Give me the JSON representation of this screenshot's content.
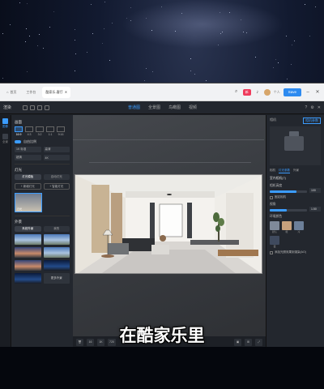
{
  "browser": {
    "tabs": [
      "首页",
      "工作台",
      "酷家乐-客厅"
    ],
    "badge": "新",
    "user": "个人",
    "save_label": "Save"
  },
  "toolbar": {
    "title": "渲染",
    "tabs": [
      "普通图",
      "全景图",
      "鸟瞰图",
      "视频"
    ],
    "active_tab": 0
  },
  "rail": {
    "items": [
      {
        "label": "图像",
        "active": true
      },
      {
        "label": "全景",
        "active": false
      }
    ]
  },
  "left_panel": {
    "size_title": "画面",
    "ratios": [
      "16:9",
      "4:3",
      "3:2",
      "1:1",
      "9:16"
    ],
    "selected_ratio": 0,
    "toggle_label": "自由比例",
    "fields": [
      "1K 标准",
      "高清",
      "超清",
      "4K"
    ],
    "light_title": "灯光",
    "light_tabs": [
      "灯光模板",
      "自动灯光"
    ],
    "light_buttons": [
      "+ 新增灯光",
      "+ 智能灯光"
    ],
    "light_thumb_label": "日光",
    "sky_title": "外景",
    "sky_tabs": [
      "系统外景",
      "我的"
    ],
    "more_label": "更多外景"
  },
  "bottom_bar": {
    "items": [
      "16",
      "1K",
      "720"
    ],
    "render_label": "渲染"
  },
  "right_panel": {
    "tabs": [
      "相机",
      "相机参数"
    ],
    "sub_tabs": [
      "相机",
      "灯光参数",
      "外景"
    ],
    "section_title": "室内相机(7)",
    "props": [
      {
        "label": "相机高度",
        "value": "100",
        "fill": 0.72
      },
      {
        "label": "视角",
        "value": "1.50",
        "fill": 0.45
      }
    ],
    "check_label": "固定相机",
    "swatch_title": "环境颜色",
    "swatches": [
      {
        "label": "默认",
        "color": "#7f8a9a"
      },
      {
        "label": "暖",
        "color": "#c7a17d"
      },
      {
        "label": "冷",
        "color": "#6c7f99"
      },
      {
        "label": "夜",
        "color": "#3f4a5e"
      }
    ],
    "footer_check": "添加光照效果到渲染(AO)"
  },
  "subtitle": "在酷家乐里"
}
